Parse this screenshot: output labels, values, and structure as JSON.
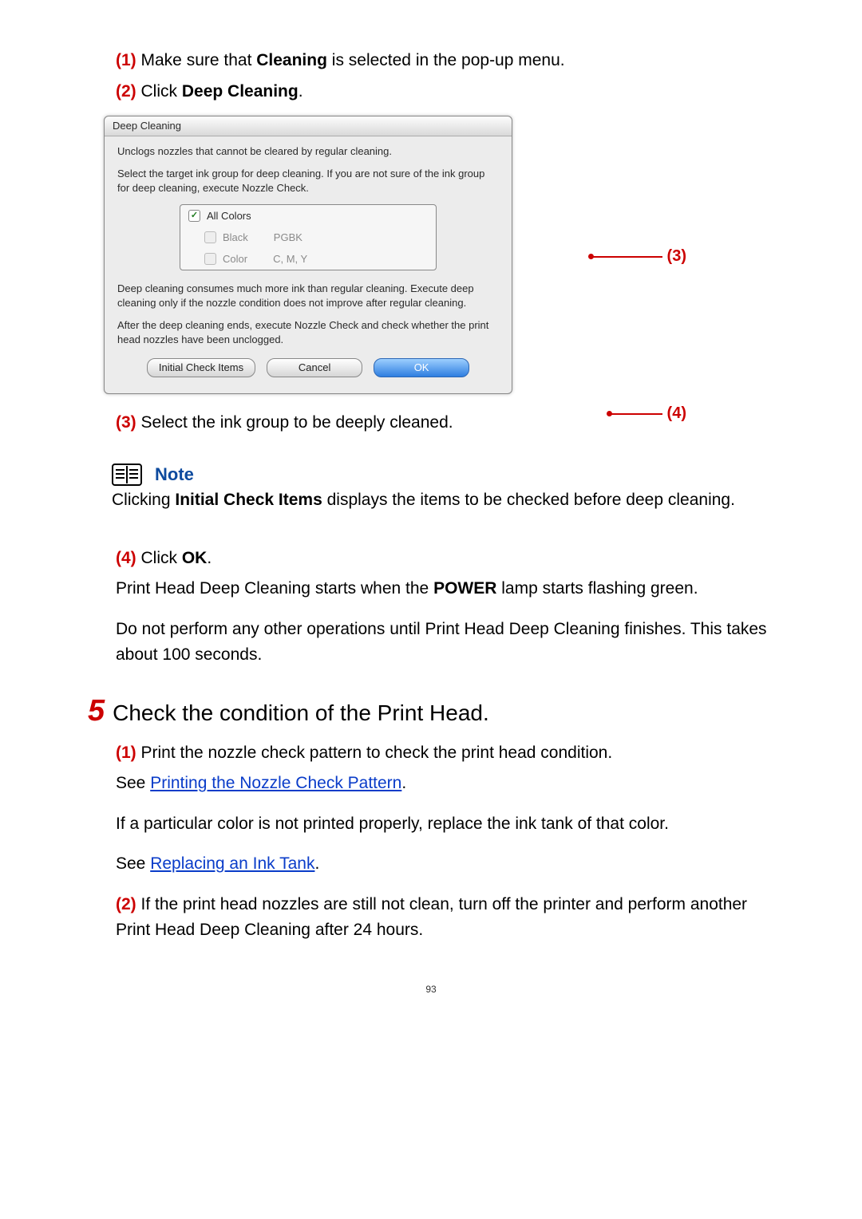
{
  "steps": {
    "s1_num": "(1)",
    "s1_text_a": " Make sure that ",
    "s1_text_b": "Cleaning",
    "s1_text_c": " is selected in the pop-up menu.",
    "s2_num": "(2)",
    "s2_text_a": " Click ",
    "s2_text_b": "Deep Cleaning",
    "s2_text_c": ".",
    "s3_num": "(3)",
    "s3_text": " Select the ink group to be deeply cleaned.",
    "s4_num": "(4)",
    "s4_text_a": " Click ",
    "s4_text_b": "OK",
    "s4_text_c": ".",
    "s4_p1_a": "Print Head Deep Cleaning starts when the ",
    "s4_p1_b": "POWER",
    "s4_p1_c": " lamp starts flashing green.",
    "s4_p2": "Do not perform any other operations until Print Head Deep Cleaning finishes. This takes about 100 seconds."
  },
  "dialog": {
    "title": "Deep Cleaning",
    "p1": "Unclogs nozzles that cannot be cleared by regular cleaning.",
    "p2": "Select the target ink group for deep cleaning. If you are not sure of the ink group for deep cleaning, execute Nozzle Check.",
    "opt_all": "All Colors",
    "opt_black": "Black",
    "opt_black_desc": "PGBK",
    "opt_color": "Color",
    "opt_color_desc": "C, M, Y",
    "p3": "Deep cleaning consumes much more ink than regular cleaning. Execute deep cleaning only if the nozzle condition does not improve after regular cleaning.",
    "p4": "After the deep cleaning ends, execute Nozzle Check and check whether the print head nozzles have been unclogged.",
    "btn_initial": "Initial Check Items",
    "btn_cancel": "Cancel",
    "btn_ok": "OK",
    "callout3": "(3)",
    "callout4": "(4)"
  },
  "note": {
    "label": "Note",
    "body_a": "Clicking ",
    "body_b": "Initial Check Items",
    "body_c": " displays the items to be checked before deep cleaning."
  },
  "bigstep": {
    "num": "5",
    "text": "Check the condition of the Print Head."
  },
  "step5": {
    "s1_num": "(1)",
    "s1_text": " Print the nozzle check pattern to check the print head condition.",
    "see1_a": "See ",
    "see1_link": "Printing the Nozzle Check Pattern",
    "see1_c": ".",
    "p_color": "If a particular color is not printed properly, replace the ink tank of that color.",
    "see2_a": "See ",
    "see2_link": "Replacing an Ink Tank",
    "see2_c": ".",
    "s2_num": "(2)",
    "s2_text": " If the print head nozzles are still not clean, turn off the printer and perform another Print Head Deep Cleaning after 24 hours."
  },
  "page_number": "93"
}
